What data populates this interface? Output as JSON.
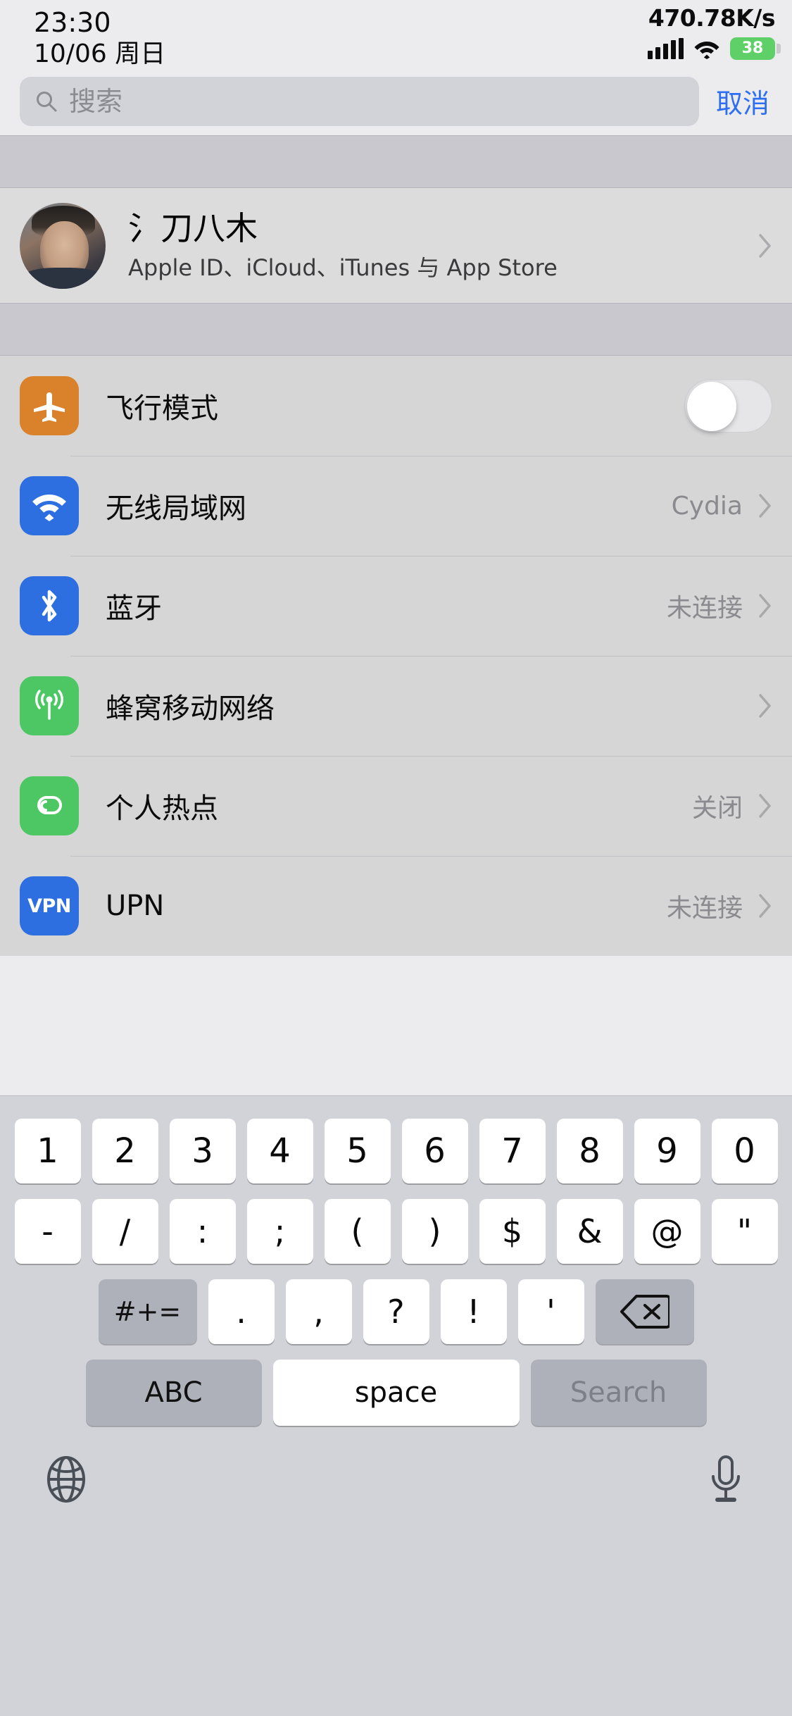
{
  "status_bar": {
    "time": "23:30",
    "date": "10/06 周日",
    "network_speed": "470.78K/s",
    "battery_level": "38",
    "signal_icon": "signal-bars-icon",
    "wifi_icon": "wifi-icon",
    "battery_icon": "battery-icon",
    "battery_color": "#5FD068"
  },
  "search": {
    "placeholder": "搜索",
    "value": "",
    "cancel_label": "取消",
    "icon": "search-icon",
    "accent_color": "#2E6FF2"
  },
  "profile": {
    "name": "氵刀八木",
    "subtitle": "Apple ID、iCloud、iTunes 与 App Store",
    "avatar": "user-avatar",
    "chevron": "chevron-right-icon"
  },
  "settings_rows": [
    {
      "label": "飞行模式",
      "icon": "airplane-icon",
      "icon_color": "#D9822B",
      "control": "toggle",
      "toggle_on": false,
      "value": ""
    },
    {
      "label": "无线局域网",
      "icon": "wifi-icon",
      "icon_color": "#2D6FE0",
      "control": "chevron",
      "value": "Cydia"
    },
    {
      "label": "蓝牙",
      "icon": "bluetooth-icon",
      "icon_color": "#2D6FE0",
      "control": "chevron",
      "value": "未连接"
    },
    {
      "label": "蜂窝移动网络",
      "icon": "cellular-icon",
      "icon_color": "#4CC764",
      "control": "chevron",
      "value": ""
    },
    {
      "label": "个人热点",
      "icon": "hotspot-icon",
      "icon_color": "#4CC764",
      "control": "chevron",
      "value": "关闭"
    },
    {
      "label": "UPN",
      "icon": "vpn-icon",
      "icon_label": "VPN",
      "icon_color": "#2D6FE0",
      "control": "chevron",
      "value": "未连接"
    }
  ],
  "keyboard": {
    "layout": "numeric-symbols",
    "row_numbers": [
      "1",
      "2",
      "3",
      "4",
      "5",
      "6",
      "7",
      "8",
      "9",
      "0"
    ],
    "row_symbols": [
      "-",
      "/",
      ":",
      ";",
      "(",
      ")",
      "$",
      "&",
      "@",
      "\""
    ],
    "row_punct": [
      ".",
      ",",
      "?",
      "!",
      "'"
    ],
    "shift_label": "#+=",
    "delete_icon": "backspace-icon",
    "abc_label": "ABC",
    "space_label": "space",
    "return_label": "Search",
    "globe_icon": "globe-icon",
    "mic_icon": "microphone-icon"
  }
}
